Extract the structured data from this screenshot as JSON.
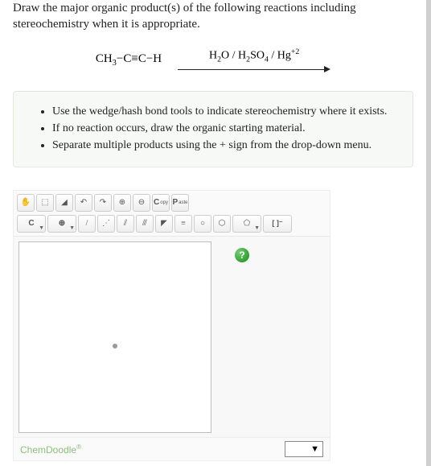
{
  "prompt": "Draw the major organic product(s) of the following reactions including stereochemistry when it is appropriate.",
  "reaction": {
    "reactant_html": "CH<sub>3</sub>−C≡C−H",
    "conditions_html": "H<sub>2</sub>O / H<sub>2</sub>SO<sub>4</sub> / Hg<sup>+2</sup>"
  },
  "hints": [
    "Use the wedge/hash bond tools to indicate stereochemistry where it exists.",
    "If no reaction occurs, draw the organic starting material.",
    "Separate multiple products using the + sign from the drop-down menu."
  ],
  "toolbar_row1": {
    "hand": "✋",
    "lasso": "⬚",
    "eraser": "◢",
    "undo": "↶",
    "redo": "↷",
    "zoom_in": "⊕",
    "zoom_out": "⊖",
    "copy": "C",
    "copy_sub": "opy",
    "paste": "P",
    "paste_sub": "aste"
  },
  "toolbar_row2": {
    "elem": "C",
    "charge": "⊕",
    "bond1": "/",
    "bond_chain": "⋰",
    "bond2": "⫽",
    "bond3": "⫻",
    "wedge": "◤",
    "hash": "≡",
    "ring1": "○",
    "ring2": "⬡",
    "ring3": "⬠",
    "brackets": "[ ]⁻"
  },
  "help_label": "?",
  "footer": {
    "brand": "ChemDoodle",
    "dropdown": "▼"
  }
}
